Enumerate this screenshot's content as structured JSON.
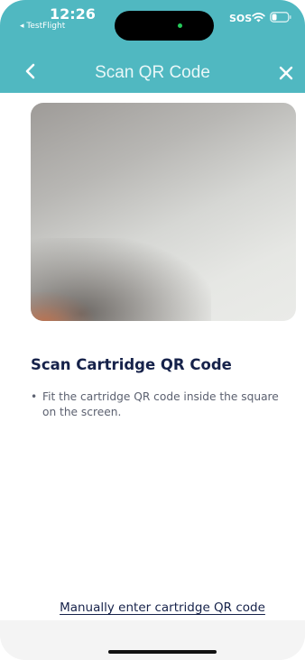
{
  "status_bar": {
    "time": "12:26",
    "back_app": "◂ TestFlight",
    "sos": "SOS",
    "wifi_icon": "wifi-icon",
    "battery_icon": "battery-icon"
  },
  "nav": {
    "title": "Scan QR Code",
    "back_icon": "chevron-left-icon",
    "close_icon": "close-icon"
  },
  "main": {
    "heading": "Scan Cartridge QR Code",
    "instructions": [
      {
        "bullet": "•",
        "text": "Fit the cartridge QR code inside the square on the screen."
      }
    ],
    "manual_link": "Manually enter cartridge QR code"
  },
  "colors": {
    "header_bg": "#50b8c1",
    "heading_text": "#16224a",
    "body_text": "#5c6170",
    "footer_bg": "#f4f4f4"
  }
}
